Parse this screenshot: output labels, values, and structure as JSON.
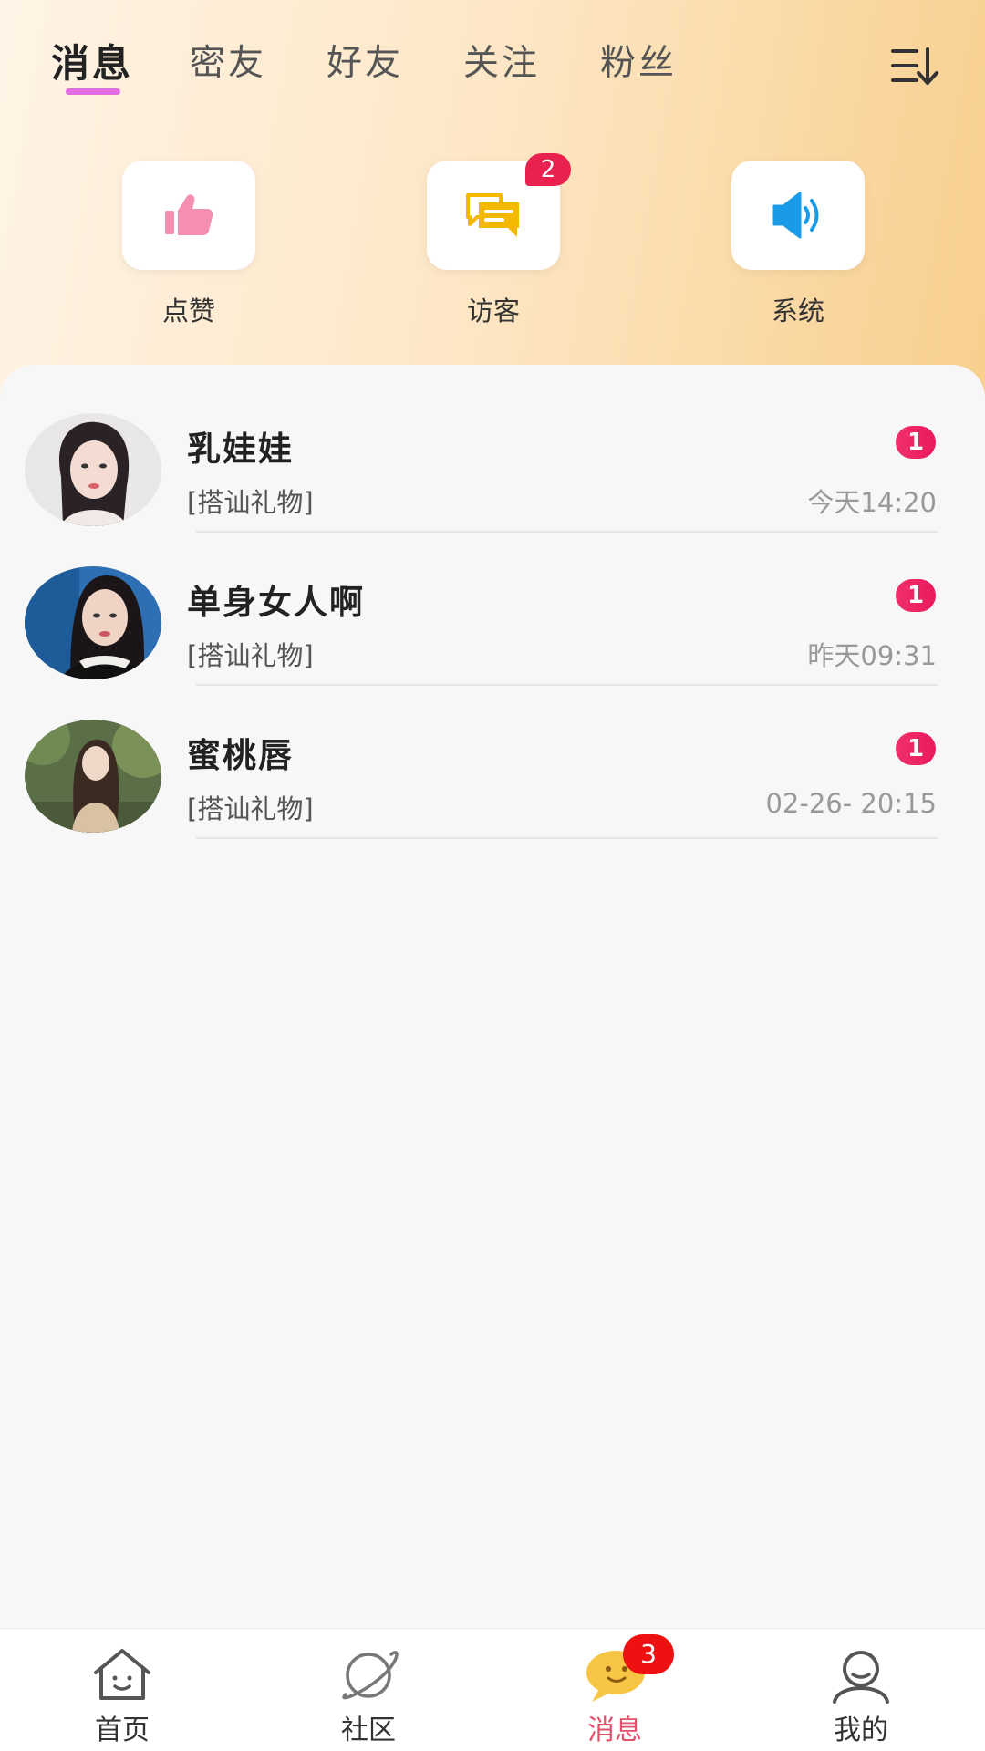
{
  "tabs": [
    "消息",
    "密友",
    "好友",
    "关注",
    "粉丝"
  ],
  "quick_actions": [
    {
      "label": "点赞",
      "icon": "thumbs-up-icon",
      "color": "#f58fb1"
    },
    {
      "label": "访客",
      "icon": "chat-bubbles-icon",
      "color": "#f5b800",
      "badge": "2"
    },
    {
      "label": "系统",
      "icon": "speaker-icon",
      "color": "#1a9be8"
    }
  ],
  "conversations": [
    {
      "name": "乳娃娃",
      "message": "[搭讪礼物]",
      "time": "今天14:20",
      "unread": "1"
    },
    {
      "name": "单身女人啊",
      "message": "[搭讪礼物]",
      "time": "昨天09:31",
      "unread": "1"
    },
    {
      "name": "蜜桃唇",
      "message": "[搭讪礼物]",
      "time": "02-26- 20:15",
      "unread": "1"
    }
  ],
  "bottom_nav": [
    {
      "label": "首页",
      "icon": "home-icon"
    },
    {
      "label": "社区",
      "icon": "planet-icon"
    },
    {
      "label": "消息",
      "icon": "message-icon",
      "badge": "3",
      "active": true
    },
    {
      "label": "我的",
      "icon": "profile-icon"
    }
  ],
  "colors": {
    "accent_pink": "#e46de4",
    "badge_red": "#e8214f",
    "active_nav": "#e2506b"
  }
}
